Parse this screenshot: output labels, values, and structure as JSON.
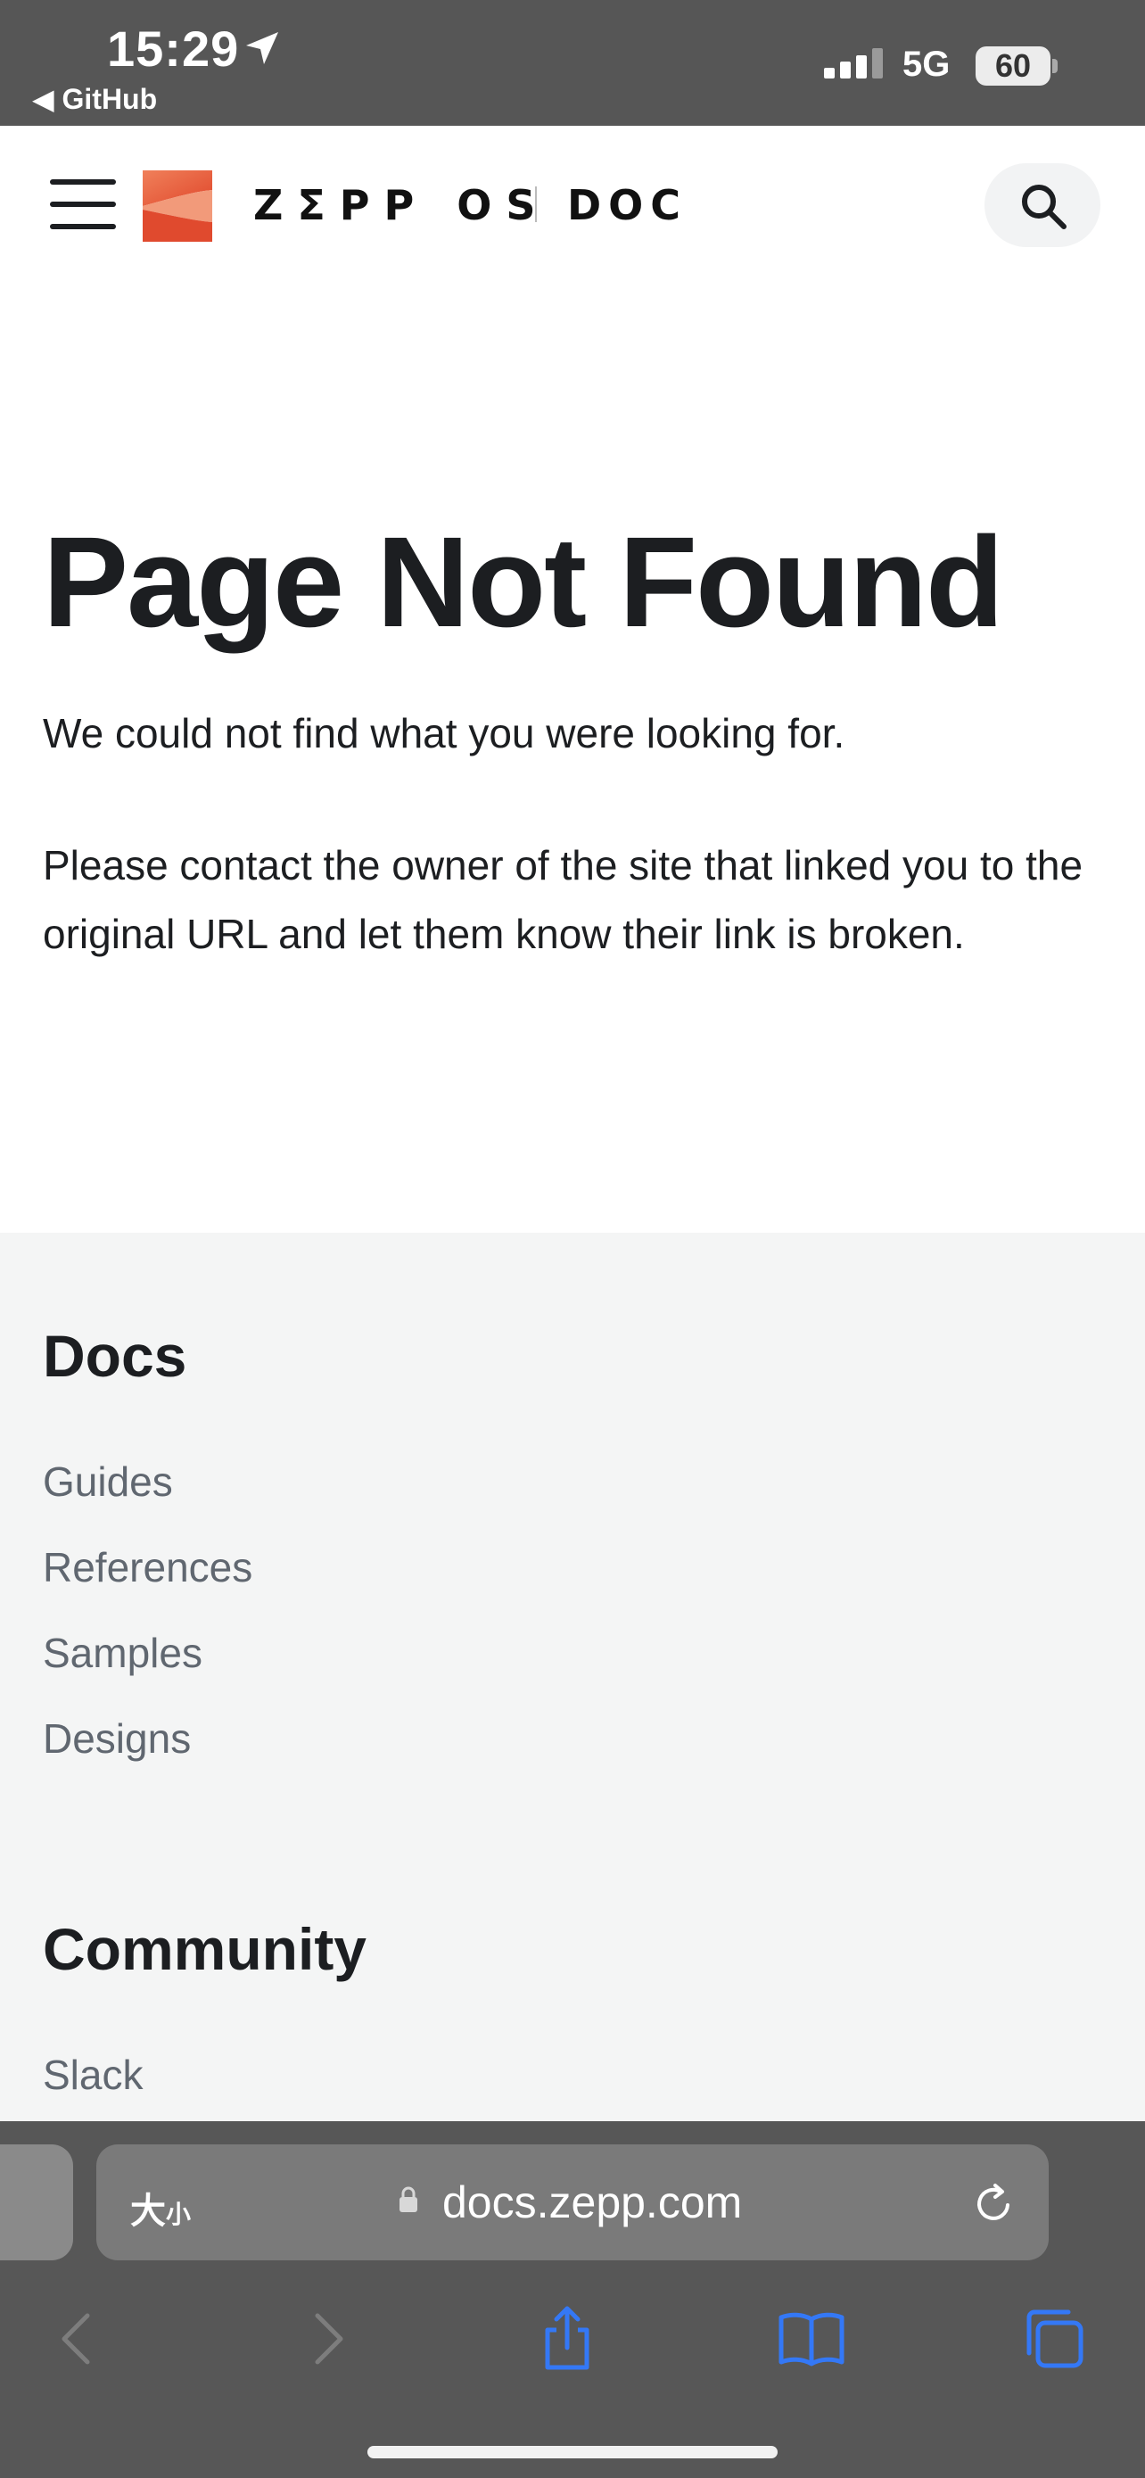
{
  "status_bar": {
    "time": "15:29",
    "back_app": "◀ GitHub",
    "network": "5G",
    "battery": "60"
  },
  "header": {
    "brand": "ZΣPP OS",
    "section": "DOC"
  },
  "main": {
    "title": "Page Not Found",
    "paragraph1": "We could not find what you were looking for.",
    "paragraph2": "Please contact the owner of the site that linked you to the original URL and let them know their link is broken."
  },
  "footer": {
    "docs_title": "Docs",
    "docs_links": [
      "Guides",
      "References",
      "Samples",
      "Designs"
    ],
    "community_title": "Community",
    "community_links": [
      "Slack"
    ]
  },
  "browser": {
    "text_size_label": "大",
    "text_size_small": "小",
    "url": "docs.zepp.com"
  },
  "colors": {
    "accent_blue": "#3478f6",
    "logo_orange": "#e8613c",
    "status_bg": "#565656"
  }
}
